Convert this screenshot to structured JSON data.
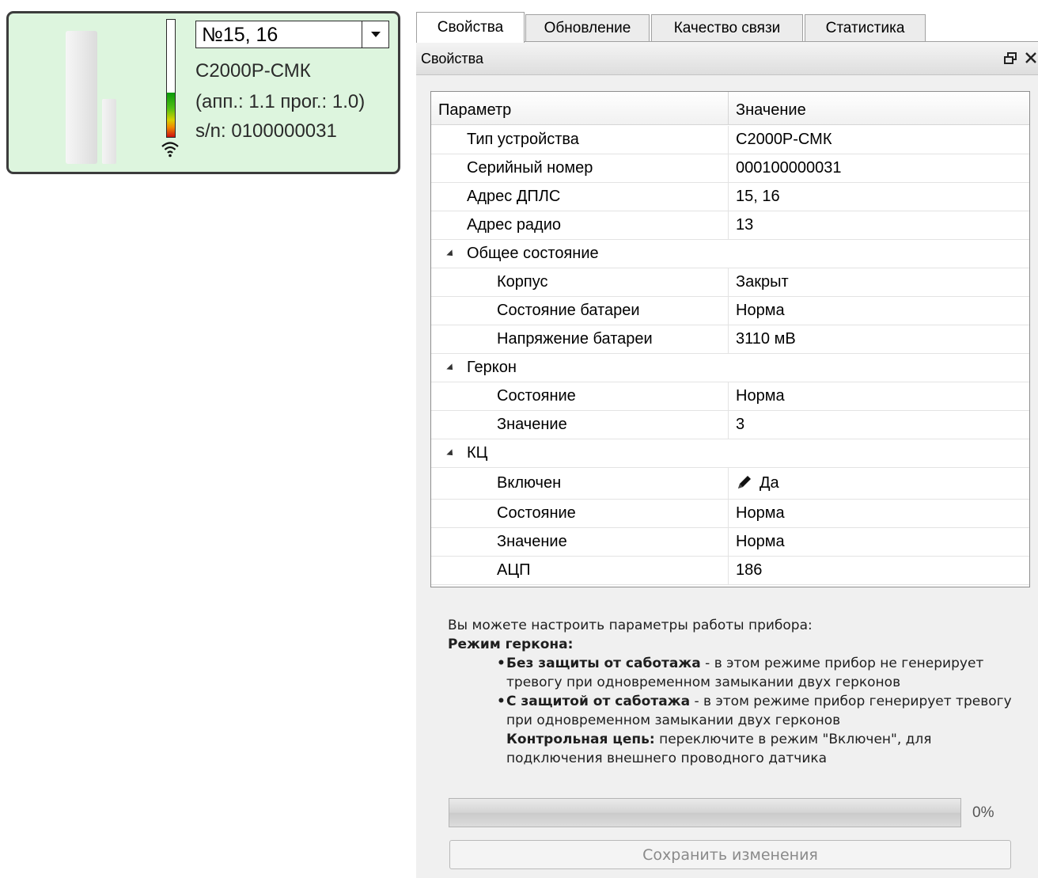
{
  "device": {
    "address_selected": "№15, 16",
    "model": "С2000Р-СМК",
    "versions": "(апп.: 1.1 прог.: 1.0)",
    "serial": "s/n: 0100000031",
    "signal_level": 0.38,
    "card_color": "#ddf5de"
  },
  "tabs": [
    {
      "label": "Свойства",
      "active": true
    },
    {
      "label": "Обновление",
      "active": false
    },
    {
      "label": "Качество связи",
      "active": false
    },
    {
      "label": "Статистика",
      "active": false
    }
  ],
  "panel": {
    "title": "Свойства",
    "icons": [
      "restore-icon",
      "close-icon"
    ]
  },
  "grid": {
    "col_param": "Параметр",
    "col_value": "Значение",
    "rows": [
      {
        "key": "Тип устройства",
        "value": "С2000Р-СМК"
      },
      {
        "key": "Серийный номер",
        "value": "000100000031"
      },
      {
        "key": "Адрес ДПЛС",
        "value": "15, 16"
      },
      {
        "key": "Адрес радио",
        "value": "13"
      },
      {
        "key": "Общее состояние",
        "value": ""
      },
      {
        "key": "Корпус",
        "value": "Закрыт"
      },
      {
        "key": "Состояние батареи",
        "value": "Норма"
      },
      {
        "key": "Напряжение батареи",
        "value": "3110 мВ"
      },
      {
        "key": "Геркон",
        "value": ""
      },
      {
        "key": "Состояние",
        "value": "Норма"
      },
      {
        "key": "Значение",
        "value": "3"
      },
      {
        "key": "КЦ",
        "value": ""
      },
      {
        "key": "Включен",
        "value": "Да"
      },
      {
        "key": "Состояние",
        "value": "Норма"
      },
      {
        "key": "Значение",
        "value": "Норма"
      },
      {
        "key": "АЦП",
        "value": "186"
      }
    ]
  },
  "help": {
    "intro": "Вы можете настроить параметры работы прибора:",
    "mode_title": "Режим геркона:",
    "item1_bold": "Без защиты от саботажа",
    "item1_text": " - в этом режиме прибор не генерирует тревогу при одновременном замыкании двух герконов",
    "item2_bold": "С защитой от саботажа",
    "item2_text": " - в этом режиме прибор генерирует тревогу при одновременном замыкании двух герконов",
    "item3_bold": "Контрольная цепь:",
    "item3_text": " переключите в режим \"Включен\", для подключения внешнего проводного датчика"
  },
  "progress": {
    "text": "0%",
    "value": 0
  },
  "save_label": "Сохранить изменения"
}
